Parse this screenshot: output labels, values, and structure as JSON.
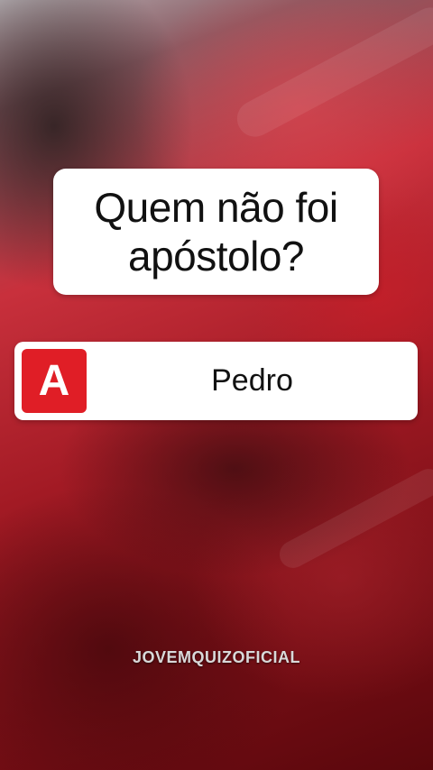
{
  "question": {
    "text": "Quem não foi apóstolo?"
  },
  "answer": {
    "letter": "A",
    "text": "Pedro"
  },
  "watermark": "JOVEMQUIZOFICIAL",
  "colors": {
    "letter_badge": "#e01e26",
    "card": "#ffffff",
    "background_primary": "#a21a24"
  }
}
